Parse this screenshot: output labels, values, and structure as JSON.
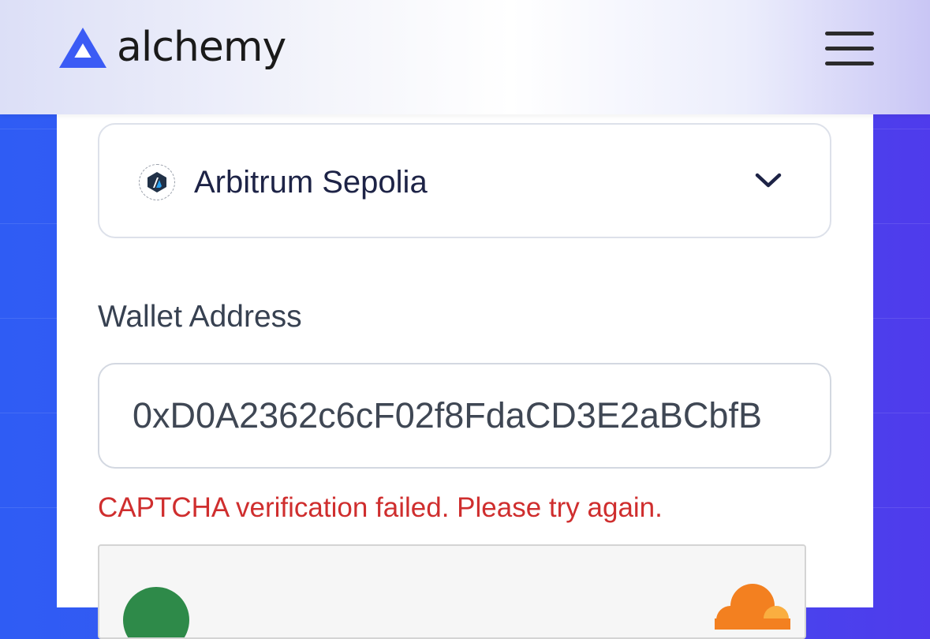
{
  "header": {
    "brand_name": "alchemy",
    "brand_color": "#3b5bf5",
    "logo_icon": "alchemy-triangle-icon",
    "menu_icon": "hamburger-menu-icon"
  },
  "network": {
    "selected": "Arbitrum Sepolia",
    "icon": "arbitrum-icon",
    "dropdown_icon": "chevron-down-icon"
  },
  "wallet": {
    "label": "Wallet Address",
    "value": "0xD0A2362c6cF02f8FdaCD3E2aBCbfB"
  },
  "error": {
    "message": "CAPTCHA verification failed. Please try again.",
    "color": "#cf2e2e"
  },
  "captcha": {
    "status_icon": "captcha-status-icon",
    "provider_icon": "cloudflare-icon"
  }
}
